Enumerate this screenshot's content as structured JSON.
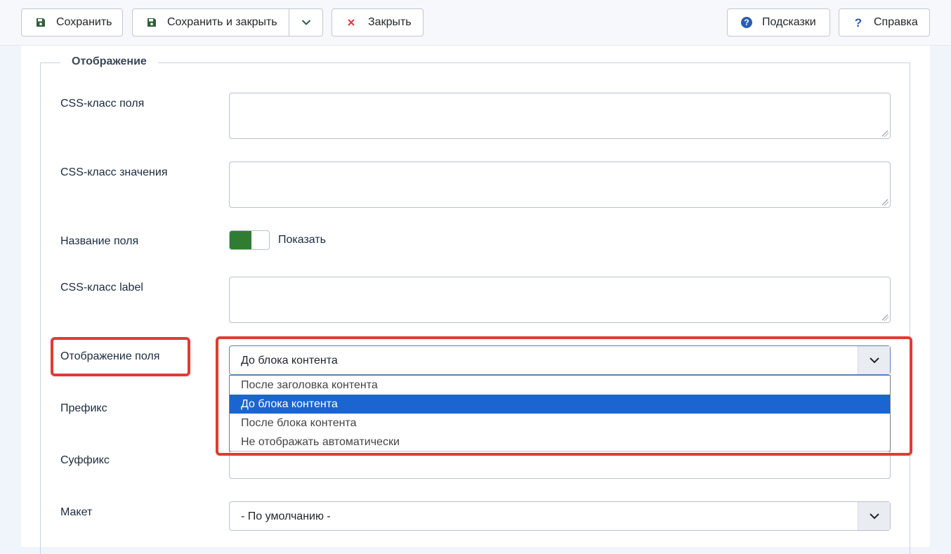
{
  "toolbar": {
    "save_label": "Сохранить",
    "save_close_label": "Сохранить и закрыть",
    "close_label": "Закрыть",
    "tips_label": "Подсказки",
    "help_label": "Справка"
  },
  "icons": {
    "save": "floppy-disk-icon",
    "close": "x-icon",
    "tips": "question-circle-icon",
    "help": "question-mark-icon",
    "dropdown": "chevron-down-icon"
  },
  "colors": {
    "accent": "#1a65d1",
    "toggle_on": "#2f7d32",
    "highlight": "#e03c33",
    "close_icon": "#d63b3b"
  },
  "section": {
    "legend": "Отображение",
    "fields": {
      "css_field_class": {
        "label": "CSS-класс поля",
        "value": ""
      },
      "css_value_class": {
        "label": "CSS-класс значения",
        "value": ""
      },
      "field_name": {
        "label": "Название поля",
        "toggle_text": "Показать"
      },
      "css_label_class": {
        "label": "CSS-класс label",
        "value": ""
      },
      "display": {
        "label": "Отображение поля",
        "selected": "До блока контента",
        "options": [
          "После заголовка контента",
          "До блока контента",
          "После блока контента",
          "Не отображать автоматически"
        ]
      },
      "prefix": {
        "label": "Префикс",
        "value": ""
      },
      "suffix": {
        "label": "Суффикс",
        "value": ""
      },
      "layout": {
        "label": "Макет",
        "selected": "- По умолчанию -"
      }
    }
  }
}
